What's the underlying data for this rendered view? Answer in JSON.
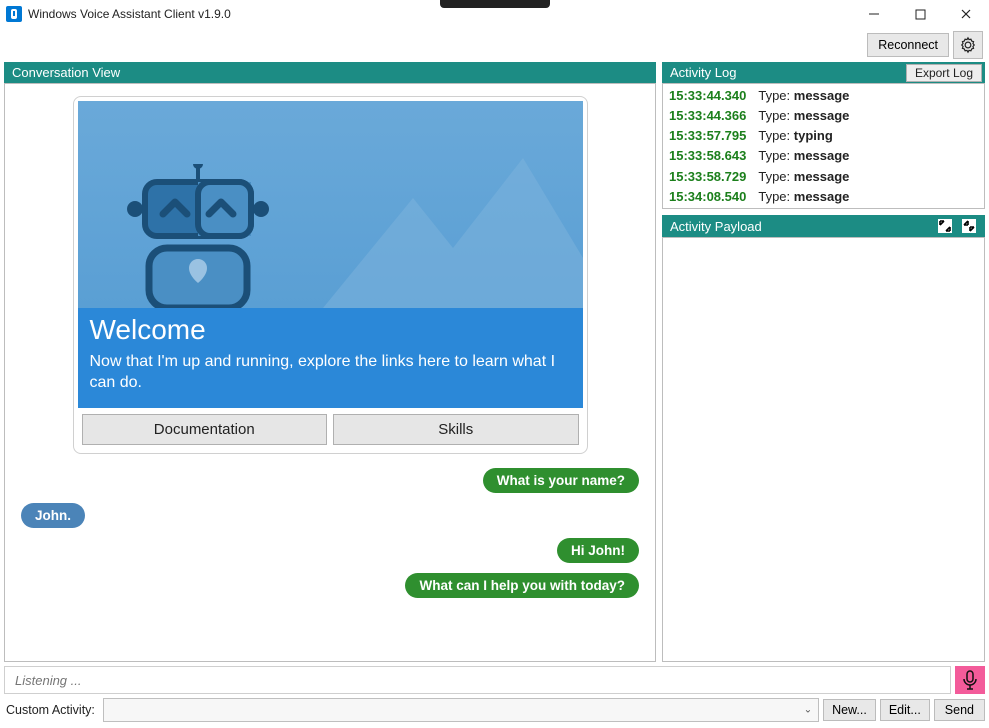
{
  "window": {
    "title": "Windows Voice Assistant Client v1.9.0"
  },
  "toolbar": {
    "reconnect": "Reconnect"
  },
  "conversation": {
    "header": "Conversation View",
    "welcome": {
      "title": "Welcome",
      "subtitle": "Now that I'm up and running, explore the links here to learn what I can do.",
      "buttons": {
        "docs": "Documentation",
        "skills": "Skills"
      }
    },
    "messages": [
      {
        "side": "right",
        "color": "green",
        "text": "What is your name?"
      },
      {
        "side": "left",
        "color": "blue",
        "text": "John."
      },
      {
        "side": "right",
        "color": "green",
        "text": "Hi John!"
      },
      {
        "side": "right",
        "color": "green",
        "text": "What can I help you with today?"
      }
    ]
  },
  "activityLog": {
    "header": "Activity Log",
    "export": "Export Log",
    "typePrefix": "Type: ",
    "entries": [
      {
        "time": "15:33:44.340",
        "type": "message"
      },
      {
        "time": "15:33:44.366",
        "type": "message"
      },
      {
        "time": "15:33:57.795",
        "type": "typing"
      },
      {
        "time": "15:33:58.643",
        "type": "message"
      },
      {
        "time": "15:33:58.729",
        "type": "message"
      },
      {
        "time": "15:34:08.540",
        "type": "message"
      }
    ]
  },
  "payload": {
    "header": "Activity Payload"
  },
  "input": {
    "placeholder": "Listening ..."
  },
  "customActivity": {
    "label": "Custom Activity:",
    "new": "New...",
    "edit": "Edit...",
    "send": "Send"
  }
}
